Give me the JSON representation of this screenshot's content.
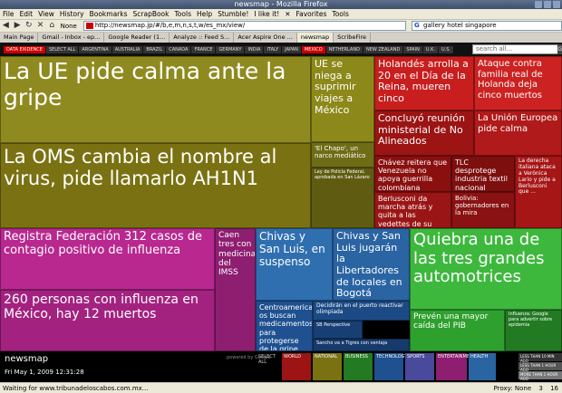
{
  "window": {
    "title": "newsmap - Mozilla Firefox"
  },
  "menu": [
    "File",
    "Edit",
    "View",
    "History",
    "Bookmarks",
    "ScrapBook",
    "Tools",
    "Help",
    "Stumble!",
    "I like it!",
    "Favorites",
    "Tools"
  ],
  "nav": {
    "none_label": "None",
    "url": "http://newsmap.jp/#/b,e,m,n,s,t,w/es_mx/view/",
    "search": "gallery hotel singapore"
  },
  "tabs": [
    "Main Page",
    "Gmail - Inbox - ep...",
    "Google Reader (1...",
    "Analyze :: Feed S...",
    "Acer Aspire One ...",
    "newsmap",
    "ScribeFire"
  ],
  "newsmap": {
    "top": {
      "edition": "DATA EXIDENCE",
      "select_all": "SELECT ALL",
      "search_placeholder": "search all...",
      "go": "Go"
    },
    "countries": [
      "ARGENTINA",
      "AUSTRALIA",
      "BRAZIL",
      "CANADA",
      "FRANCE",
      "GERMANY",
      "INDIA",
      "ITALY",
      "JAPAN",
      "MEXICO",
      "NETHERLAND",
      "NEW ZEALAND",
      "SPAIN",
      "U.K.",
      "U.S."
    ],
    "selected_country": "MEXICO",
    "headlines": [
      {
        "id": "h1",
        "text": "La UE pide calma ante la gripe",
        "color": "#8f8a1f"
      },
      {
        "id": "h2",
        "text": "La OMS cambia el nombre al virus, pide llamarlo AH1N1",
        "color": "#7a7212"
      },
      {
        "id": "h3",
        "text": "UE se niega a suprimir viajes a México",
        "color": "#8c891a"
      },
      {
        "id": "h4",
        "text": "'El Chapo', un narco mediático",
        "color": "#6f6c16"
      },
      {
        "id": "h5",
        "text": "Ley de Policía Federal, aprobada en San Lázaro",
        "color": "#5f5c12"
      },
      {
        "id": "h6",
        "text": "Holandés arrolla a 20 en el Día de la Reina, mueren cinco",
        "color": "#c81e1e"
      },
      {
        "id": "h7",
        "text": "Ataque contra familia real de Holanda deja cinco muertos",
        "color": "#cc2222"
      },
      {
        "id": "h8",
        "text": "Concluyó reunión ministerial de No Alineados",
        "color": "#9c1414"
      },
      {
        "id": "h9",
        "text": "La Unión Europea pide calma",
        "color": "#b01a1a"
      },
      {
        "id": "h10",
        "text": "Chávez reitera que Venezuela no apoya guerrilla colombiana",
        "color": "#8a1010"
      },
      {
        "id": "h11",
        "text": "TLC desprotege industria textil nacional",
        "color": "#7e0f0f"
      },
      {
        "id": "h12",
        "text": "La derecha italiana ataca a Verónica Lario y pide a Berlusconi que ...",
        "color": "#a61616"
      },
      {
        "id": "h13",
        "text": "Berlusconi da marcha atrás y quita a las vedettes de su lista",
        "color": "#9a1515"
      },
      {
        "id": "h14",
        "text": "Bolivia: gobernadores en la mira",
        "color": "#8a1212"
      },
      {
        "id": "h15",
        "text": "Registra Federación 312 casos de contagio positivo de influenza",
        "color": "#b8288f"
      },
      {
        "id": "h16",
        "text": "260 personas con influenza en México, hay 12 muertos",
        "color": "#a32280"
      },
      {
        "id": "h17",
        "text": "Caen tres con medicina del IMSS",
        "color": "#8e1e70"
      },
      {
        "id": "h18",
        "text": "Chivas y San Luis, en suspenso",
        "color": "#2f6fb0"
      },
      {
        "id": "h19",
        "text": "Chivas y San Luis jugarán la Libertadores de locales en Bogotá",
        "color": "#2a64a3"
      },
      {
        "id": "h20",
        "text": "Centroamerican os buscan medicamentos para protegerse de la gripe ...",
        "color": "#1f5090"
      },
      {
        "id": "h21",
        "text": "Quiebra una de las tres grandes automotrices",
        "color": "#3db83d"
      },
      {
        "id": "h22",
        "text": "Prevén una mayor caída del PIB",
        "color": "#2ea02e"
      },
      {
        "id": "h23",
        "text": "Decidirán en el puerto reactivar olimpiada",
        "color": "#1c4a85"
      },
      {
        "id": "h24",
        "text": "SB Perspective",
        "color": "#183f73"
      },
      {
        "id": "h25",
        "text": "Sancho va a Tigres con ventaja",
        "color": "#163a6b"
      },
      {
        "id": "h26",
        "text": "Influenza: Google para advertir sobre epidemia",
        "color": "#227a22"
      }
    ],
    "bottom": {
      "logo": "newsmap",
      "date": "Fri May 1, 2009 12:31:28",
      "powered": "powered by Google",
      "select_all": "SELECT ALL",
      "categories": [
        "WORLD",
        "NATIONAL",
        "BUSINESS",
        "TECHNOLOGY",
        "SPORTS",
        "ENTERTAINMENT",
        "HEALTH"
      ],
      "time_labels": [
        "LESS THAN 10 MIN AGO",
        "LESS THAN 1 HOUR AGO",
        "MORE THAN 1 HOUR AGO"
      ]
    }
  },
  "status": {
    "text": "Waiting for www.tribunadeloscabos.com.mx...",
    "proxy": "Proxy: None",
    "count": "3",
    "count2": "16"
  }
}
